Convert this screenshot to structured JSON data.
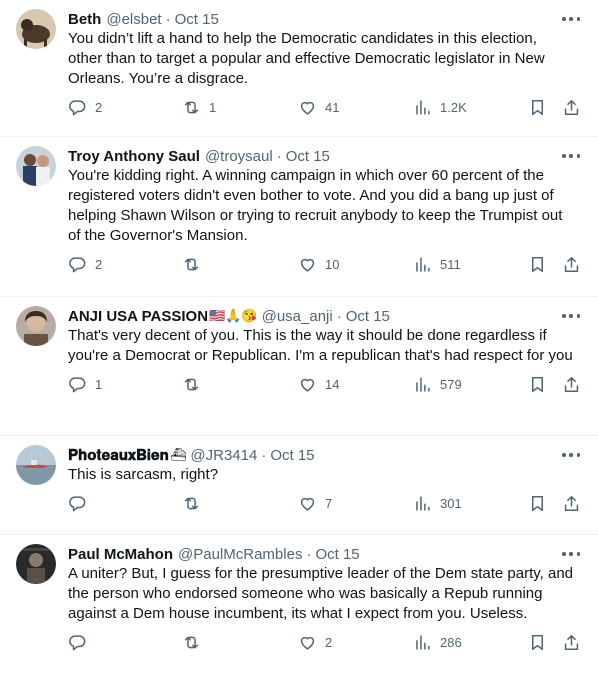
{
  "tweets": [
    {
      "name": "Beth",
      "emoji": "",
      "handle": "@elsbet",
      "sep": "·",
      "date": "Oct 15",
      "text": "You didn’t lift a hand to help the Democratic candidates in this election, other than to target a popular and effective Democratic legislator in New Orleans. You’re a disgrace.",
      "replies": "2",
      "retweets": "1",
      "likes": "41",
      "views": "1.2K"
    },
    {
      "name": "Troy Anthony Saul",
      "emoji": "",
      "handle": "@troysaul",
      "sep": "·",
      "date": "Oct 15",
      "text": "You're kidding right. A winning campaign in which over 60 percent of the registered voters didn't even bother to vote. And you did a bang up just of helping Shawn Wilson or trying to recruit anybody to keep the Trumpist out of the Governor's Mansion.",
      "replies": "2",
      "retweets": "",
      "likes": "10",
      "views": "511"
    },
    {
      "name": "ANJI USA PASSION",
      "emoji": "🇺🇸🙏😘",
      "handle": "@usa_anji",
      "sep": "·",
      "date": "Oct 15",
      "text": "That's very decent of you. This is the way it should be done regardless if you're a Democrat or Republican. I'm a republican that's had respect for you",
      "replies": "1",
      "retweets": "",
      "likes": "14",
      "views": "579"
    },
    {
      "name": "𝐏𝐡𝐨𝐭𝐞𝐚𝐮𝐱𝐁𝐢𝐞𝐧",
      "emoji": "⛴",
      "handle": "@JR3414",
      "sep": "·",
      "date": "Oct 15",
      "text": "This is sarcasm, right?",
      "replies": "",
      "retweets": "",
      "likes": "7",
      "views": "301"
    },
    {
      "name": "Paul McMahon",
      "emoji": "",
      "handle": "@PaulMcRambles",
      "sep": "·",
      "date": "Oct 15",
      "text": "A uniter? But, I guess for the presumptive leader of the Dem state party, and the person who endorsed someone who was basically a Repub running against a Dem house incumbent, its what I expect from you. Useless.",
      "replies": "",
      "retweets": "",
      "likes": "2",
      "views": "286"
    }
  ],
  "avatar_colors": [
    "#4a3a2a",
    "#8fa3b8",
    "#6b5246",
    "#9fb3c2",
    "#3a3634"
  ],
  "icons": [
    "reply-icon",
    "retweet-icon",
    "like-icon",
    "views-icon",
    "bookmark-icon",
    "share-icon",
    "more-icon"
  ]
}
